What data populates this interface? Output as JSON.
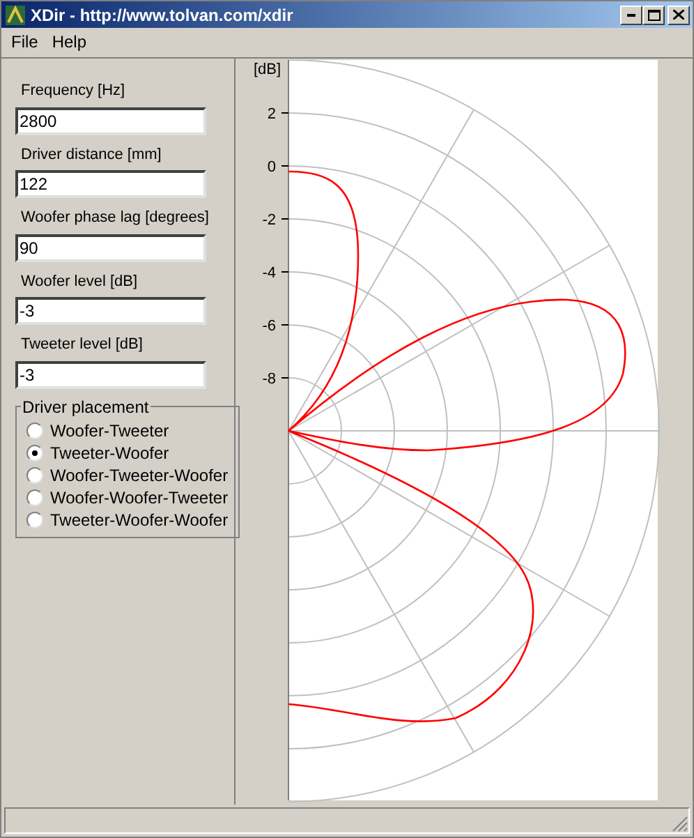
{
  "window": {
    "title": "XDir - http://www.tolvan.com/xdir"
  },
  "menu": [
    "File",
    "Help"
  ],
  "fields": [
    {
      "label": "Frequency [Hz]",
      "value": "2800"
    },
    {
      "label": "Driver distance [mm]",
      "value": "122"
    },
    {
      "label": "Woofer phase lag [degrees]",
      "value": "90"
    },
    {
      "label": "Woofer level [dB]",
      "value": "-3"
    },
    {
      "label": "Tweeter level [dB]",
      "value": "-3"
    }
  ],
  "placement": {
    "title": "Driver placement",
    "options": [
      {
        "label": "Woofer-Tweeter",
        "selected": false
      },
      {
        "label": "Tweeter-Woofer",
        "selected": true
      },
      {
        "label": "Woofer-Tweeter-Woofer",
        "selected": false
      },
      {
        "label": "Woofer-Woofer-Tweeter",
        "selected": false
      },
      {
        "label": "Tweeter-Woofer-Woofer",
        "selected": false
      }
    ]
  },
  "plot": {
    "unit_label": "[dB]",
    "ticks": [
      "2",
      "0",
      "-2",
      "-4",
      "-6",
      "-8"
    ]
  }
}
